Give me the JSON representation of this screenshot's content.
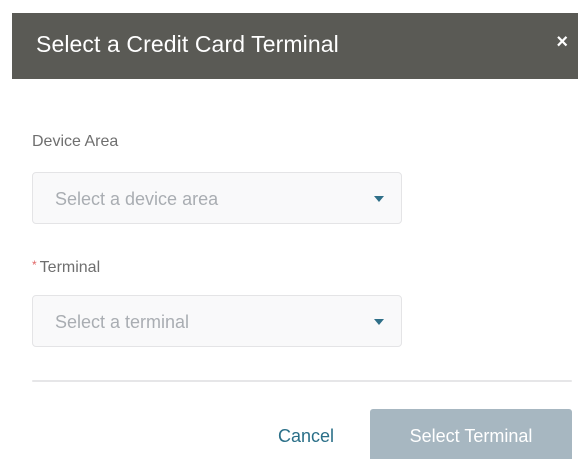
{
  "dialog": {
    "title": "Select a Credit Card Terminal",
    "close_symbol": "×"
  },
  "device_area": {
    "label": "Device Area",
    "placeholder": "Select a device area"
  },
  "terminal": {
    "required_mark": "*",
    "label": "Terminal",
    "placeholder": "Select a terminal"
  },
  "footer": {
    "cancel_label": "Cancel",
    "submit_label": "Select Terminal"
  }
}
